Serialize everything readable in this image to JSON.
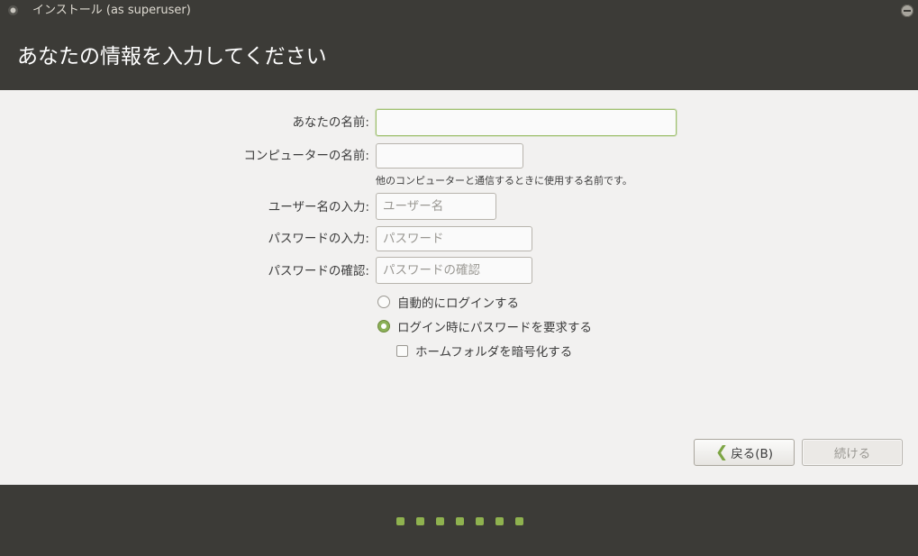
{
  "window": {
    "title": "インストール (as superuser)"
  },
  "header": {
    "title": "あなたの情報を入力してください"
  },
  "form": {
    "name": {
      "label": "あなたの名前:",
      "value": ""
    },
    "computer": {
      "label": "コンピューターの名前:",
      "value": "",
      "hint": "他のコンピューターと通信するときに使用する名前です。"
    },
    "username": {
      "label": "ユーザー名の入力:",
      "placeholder": "ユーザー名"
    },
    "password": {
      "label": "パスワードの入力:",
      "placeholder": "パスワード"
    },
    "confirm": {
      "label": "パスワードの確認:",
      "placeholder": "パスワードの確認"
    },
    "options": {
      "auto_login": "自動的にログインする",
      "require_password": "ログイン時にパスワードを要求する",
      "selected": "require_password",
      "encrypt_home": "ホームフォルダを暗号化する",
      "encrypt_home_checked": false
    }
  },
  "buttons": {
    "back": "戻る(B)",
    "continue": "続ける"
  },
  "progress": {
    "total_steps": 7,
    "accent": "#8fb24f"
  }
}
